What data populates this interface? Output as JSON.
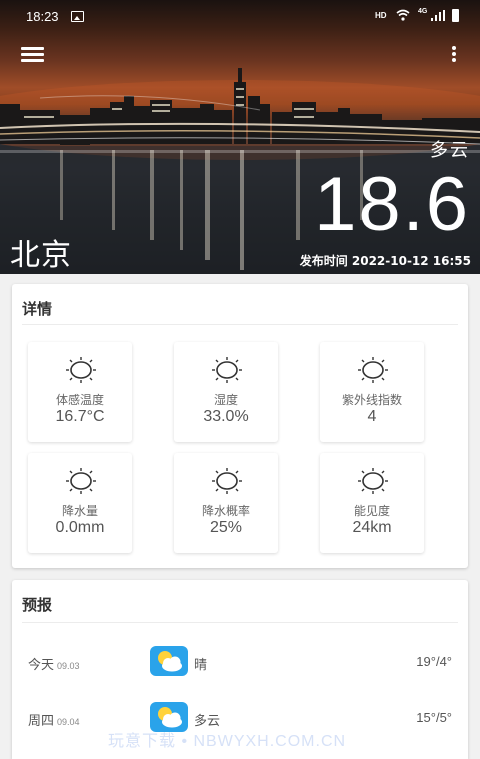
{
  "status_bar": {
    "time": "18:23",
    "network_hd": "HD",
    "network_type": "4G",
    "icons": [
      "image-icon",
      "wifi-icon",
      "signal-icon",
      "battery-icon"
    ]
  },
  "toolbar": {
    "menu_icon": "hamburger-menu-icon",
    "more_icon": "more-vert-icon"
  },
  "current": {
    "condition": "多云",
    "temperature": "18.6",
    "city": "北京",
    "publish_time": "发布时间 2022-10-12 16:55"
  },
  "details": {
    "title": "详情",
    "items": [
      {
        "icon": "sun-icon",
        "label": "体感温度",
        "value": "16.7°C"
      },
      {
        "icon": "sun-icon",
        "label": "湿度",
        "value": "33.0%"
      },
      {
        "icon": "sun-icon",
        "label": "紫外线指数",
        "value": "4"
      },
      {
        "icon": "sun-icon",
        "label": "降水量",
        "value": "0.0mm"
      },
      {
        "icon": "sun-icon",
        "label": "降水概率",
        "value": "25%"
      },
      {
        "icon": "sun-icon",
        "label": "能见度",
        "value": "24km"
      }
    ]
  },
  "forecast": {
    "title": "预报",
    "rows": [
      {
        "day": "今天",
        "date": "09.03",
        "icon": "partly-cloudy-icon",
        "condition": "晴",
        "range": "19°/4°"
      },
      {
        "day": "周四",
        "date": "09.04",
        "icon": "partly-cloudy-icon",
        "condition": "多云",
        "range": "15°/5°"
      }
    ]
  },
  "watermark": "玩意下载 • NBWYXH.COM.CN",
  "colors": {
    "accent_icon_bg": "#2aa3ea",
    "card_bg": "#ffffff",
    "page_bg": "#f1f1f1"
  }
}
